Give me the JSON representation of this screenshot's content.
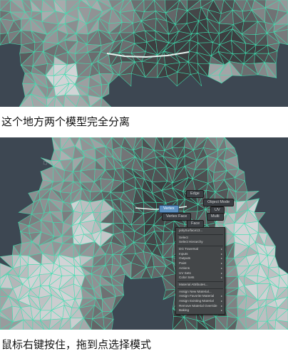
{
  "captions": {
    "first": "这个地方两个模型完全分离",
    "second": "鼠标右键按住，拖到点选择模式"
  },
  "marking_menu": {
    "edge": "Edge",
    "object_mode": "Object Mode",
    "vertex": "Vertex",
    "uv": "UV",
    "vertex_face": "Vertex Face",
    "multi": "Multi",
    "face": "Face"
  },
  "context_menu": {
    "items": [
      {
        "label": "polySurface13...",
        "sub": false
      },
      {
        "label": "Select",
        "sub": false
      },
      {
        "label": "Select Hierarchy",
        "sub": false
      },
      {
        "label": "DG Traversal",
        "sub": true
      },
      {
        "label": "Inputs",
        "sub": true
      },
      {
        "label": "Outputs",
        "sub": true
      },
      {
        "label": "Paint",
        "sub": true
      },
      {
        "label": "Actions",
        "sub": true
      },
      {
        "label": "UV Sets",
        "sub": true
      },
      {
        "label": "Color Sets",
        "sub": true
      },
      {
        "label": "Material Attributes...",
        "sub": false
      },
      {
        "label": "Assign New Material...",
        "sub": false
      },
      {
        "label": "Assign Favorite Material",
        "sub": true
      },
      {
        "label": "Assign Existing Material",
        "sub": true
      },
      {
        "label": "Remove Material Override",
        "sub": true
      },
      {
        "label": "Baking",
        "sub": true
      }
    ],
    "separators_after": [
      0,
      2,
      9,
      10
    ]
  },
  "colors": {
    "wire": "#3fe0b0",
    "mesh_dark": "#4a4c4e",
    "mesh_light": "#8a8c8e",
    "highlight": "#e8f2ee",
    "viewport_bg": "#3d4752"
  }
}
